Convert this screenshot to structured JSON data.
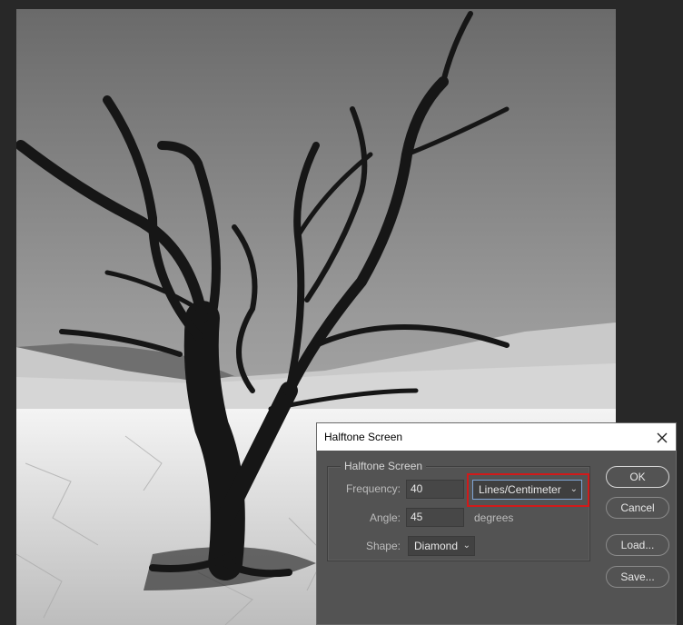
{
  "dialog": {
    "title": "Halftone Screen",
    "group_legend": "Halftone Screen",
    "frequency": {
      "label": "Frequency:",
      "value": "40",
      "unit": "Lines/Centimeter"
    },
    "angle": {
      "label": "Angle:",
      "value": "45",
      "unit": "degrees"
    },
    "shape": {
      "label": "Shape:",
      "value": "Diamond"
    },
    "buttons": {
      "ok": "OK",
      "cancel": "Cancel",
      "load": "Load...",
      "save": "Save..."
    }
  },
  "colors": {
    "dialog_bg": "#535353",
    "highlight": "#d11a1a",
    "focus_border": "#7fa5d6"
  }
}
